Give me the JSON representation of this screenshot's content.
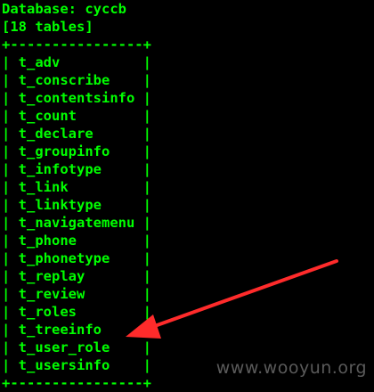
{
  "terminal": {
    "database_line": "Database: cyccb",
    "count_line": "[18 tables]",
    "border_line": "+----------------+",
    "rows": [
      "| t_adv          |",
      "| t_conscribe    |",
      "| t_contentsinfo |",
      "| t_count        |",
      "| t_declare      |",
      "| t_groupinfo    |",
      "| t_infotype     |",
      "| t_link         |",
      "| t_linktype     |",
      "| t_navigatemenu |",
      "| t_phone        |",
      "| t_phonetype    |",
      "| t_replay       |",
      "| t_review       |",
      "| t_roles        |",
      "| t_treeinfo     |",
      "| t_user_role    |",
      "| t_usersinfo    |"
    ],
    "bottom_border_line": "+----------------+",
    "text_color": "#00ff00",
    "background_color": "#000000"
  },
  "annotation": {
    "arrow_color": "#ff2b2b",
    "arrow_points_to": "t_user_role"
  },
  "watermark": {
    "text": "www.wooyun.org",
    "color": "#5a5a5a"
  }
}
